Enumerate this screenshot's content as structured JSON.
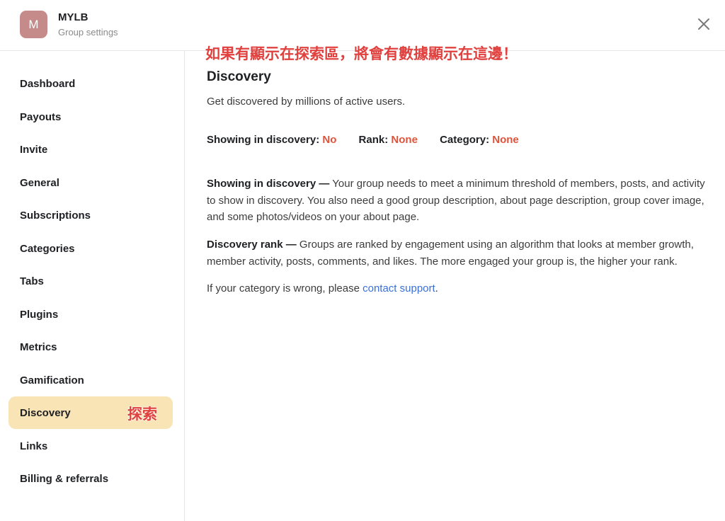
{
  "header": {
    "avatar_letter": "M",
    "group_name": "MYLB",
    "group_subtitle": "Group settings",
    "close_icon": "close-icon"
  },
  "sidebar": {
    "items": [
      {
        "label": "Dashboard"
      },
      {
        "label": "Payouts"
      },
      {
        "label": "Invite"
      },
      {
        "label": "General"
      },
      {
        "label": "Subscriptions"
      },
      {
        "label": "Categories"
      },
      {
        "label": "Tabs"
      },
      {
        "label": "Plugins"
      },
      {
        "label": "Metrics"
      },
      {
        "label": "Gamification"
      },
      {
        "label": "Discovery",
        "active": true,
        "note": "探索"
      },
      {
        "label": "Links"
      },
      {
        "label": "Billing & referrals"
      }
    ]
  },
  "annotation": "如果有顯示在探索區，將會有數據顯示在這邊！",
  "main": {
    "title": "Discovery",
    "subtitle": "Get discovered by millions of active users.",
    "stats": {
      "showing_label": "Showing in discovery:",
      "showing_value": "No",
      "rank_label": "Rank:",
      "rank_value": "None",
      "category_label": "Category:",
      "category_value": "None"
    },
    "para1_title": "Showing in discovery —",
    "para1_text": " Your group needs to meet a minimum threshold of members, posts, and activity to show in discovery. You also need a good group description, about page description, group cover image, and some photos/videos on your about page.",
    "para2_title": "Discovery rank —",
    "para2_text": " Groups are ranked by engagement using an algorithm that looks at member growth, member activity, posts, comments, and likes. The more engaged your group is, the higher your rank.",
    "para3_text": "If your category is wrong, please ",
    "para3_link": "contact support",
    "para3_end": "."
  },
  "colors": {
    "accent_red": "#e0533b",
    "annotation_red": "#e0413f",
    "active_bg": "#f8e4b5",
    "link_blue": "#3a6fd8",
    "avatar_bg": "#c58a8a"
  }
}
